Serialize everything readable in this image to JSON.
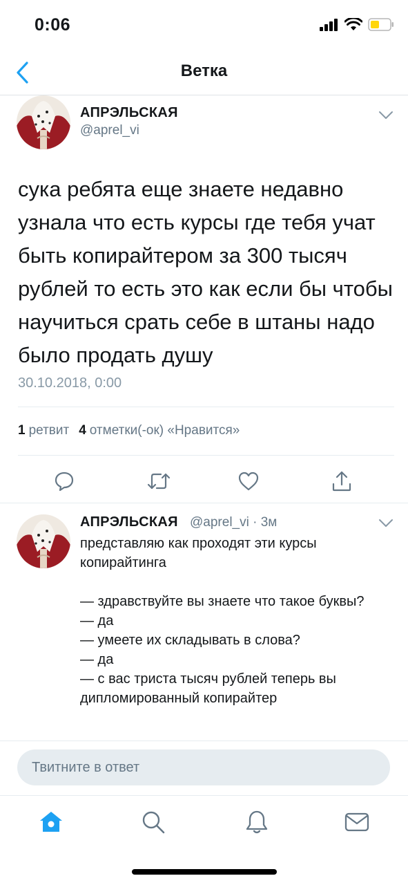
{
  "status_bar": {
    "time": "0:06"
  },
  "nav": {
    "title": "Ветка"
  },
  "main_tweet": {
    "display_name": "АПРЭЛЬСКАЯ",
    "handle": "@aprel_vi",
    "text": "сука ребята еще знаете недавно узнала что есть курсы где тебя учат быть копирайтером за 300 тысяч рублей то есть это как если бы чтобы научиться срать себе в штаны надо было продать душу",
    "date": "30.10.2018, 0:00",
    "retweet_count": "1",
    "retweet_label": "ретвит",
    "like_count": "4",
    "like_label": "отметки(-ок) «Нравится»"
  },
  "reply_tweet": {
    "display_name": "АПРЭЛЬСКАЯ",
    "handle_time": "@aprel_vi · 3м",
    "text": "представляю как проходят эти курсы копирайтинга\n\n— здравствуйте вы знаете что такое буквы?\n— да\n— умеете их складывать в слова?\n— да\n— с вас триста тысяч рублей теперь вы дипломированный копирайтер"
  },
  "compose": {
    "placeholder": "Твитните в ответ"
  },
  "icons": {
    "accent": "#1da1f2",
    "gray": "#657786",
    "actions": [
      "reply-icon",
      "retweet-icon",
      "like-icon",
      "share-icon"
    ],
    "tabs": [
      "home-icon",
      "search-icon",
      "notifications-icon",
      "messages-icon"
    ]
  }
}
